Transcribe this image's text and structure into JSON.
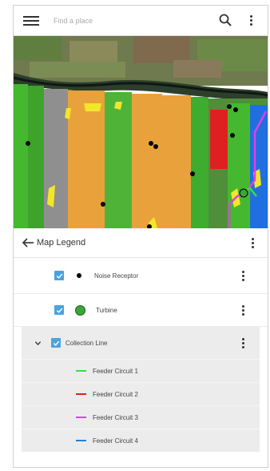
{
  "search": {
    "placeholder": "Find a place"
  },
  "legend": {
    "title": "Map Legend",
    "items": [
      {
        "label": "Noise Receptor",
        "checked": true,
        "icon": "black-dot"
      },
      {
        "label": "Turbine",
        "checked": true,
        "icon": "green-circle"
      }
    ],
    "group": {
      "label": "Collection Line",
      "checked": true,
      "expanded": true,
      "children": [
        {
          "label": "Feeder Circuit 1",
          "color": "#3cdc3c"
        },
        {
          "label": "Feeder Circuit 2",
          "color": "#e02020"
        },
        {
          "label": "Feeder Circuit 3",
          "color": "#e040e0"
        },
        {
          "label": "Feeder Circuit 4",
          "color": "#2080e0"
        }
      ]
    }
  },
  "colors": {
    "checkbox": "#4aa3df",
    "turbine": "#3aa53a",
    "parcel_green": "#46b82f",
    "parcel_orange": "#e9a23b",
    "parcel_gray": "#8f8f8f",
    "parcel_yellow": "#f2e62a",
    "parcel_red": "#e02020",
    "parcel_blue": "#1f6fe0"
  }
}
